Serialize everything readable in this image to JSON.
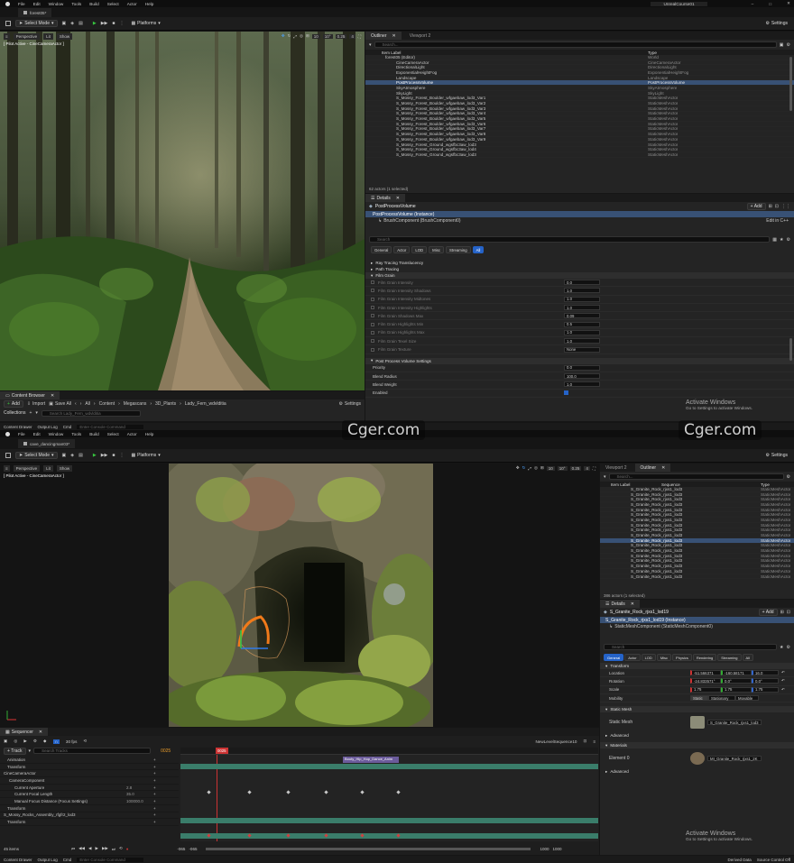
{
  "top": {
    "menu": [
      "File",
      "Edit",
      "Window",
      "Tools",
      "Build",
      "Select",
      "Actor",
      "Help"
    ],
    "tab_title": "forest05*",
    "window_title": "UnrealCourse01",
    "toolbar": {
      "select_mode": "Select Mode",
      "platforms": "Platforms",
      "settings": "Settings"
    },
    "viewport": {
      "perspective": "Perspective",
      "lit": "Lit",
      "show": "Show",
      "pilot": "[ Pilot Active - CineCameraActor ]",
      "grid": "10",
      "angle": "10°",
      "scale": "0.25",
      "cam": "4"
    },
    "outliner": {
      "tab1": "Outliner",
      "tab2": "Viewport 2",
      "search_placeholder": "Search...",
      "col_label": "Item Label",
      "col_type": "Type",
      "rows": [
        {
          "label": "forest05 (Editor)",
          "type": "World"
        },
        {
          "label": "CineCameraActor",
          "type": "CineCameraActor"
        },
        {
          "label": "DirectionalLight",
          "type": "DirectionalLight"
        },
        {
          "label": "ExponentialHeightFog",
          "type": "ExponentialHeightFog"
        },
        {
          "label": "Landscape",
          "type": "Landscape"
        },
        {
          "label": "PostProcessVolume",
          "type": "PostProcessVolume"
        },
        {
          "label": "SkyAtmosphere",
          "type": "SkyAtmosphere"
        },
        {
          "label": "SkyLight",
          "type": "SkyLight"
        },
        {
          "label": "S_Mossy_Forest_Boulder_wfgaebaw_lod3_Var1",
          "type": "StaticMeshActor"
        },
        {
          "label": "S_Mossy_Forest_Boulder_wfgaebaw_lod3_Var2",
          "type": "StaticMeshActor"
        },
        {
          "label": "S_Mossy_Forest_Boulder_wfgaebaw_lod3_Var3",
          "type": "StaticMeshActor"
        },
        {
          "label": "S_Mossy_Forest_Boulder_wfgaebaw_lod3_Var4",
          "type": "StaticMeshActor"
        },
        {
          "label": "S_Mossy_Forest_Boulder_wfgaebaw_lod3_Var5",
          "type": "StaticMeshActor"
        },
        {
          "label": "S_Mossy_Forest_Boulder_wfgaebaw_lod3_Var6",
          "type": "StaticMeshActor"
        },
        {
          "label": "S_Mossy_Forest_Boulder_wfgaebaw_lod3_Var7",
          "type": "StaticMeshActor"
        },
        {
          "label": "S_Mossy_Forest_Boulder_wfgaebaw_lod3_Var8",
          "type": "StaticMeshActor"
        },
        {
          "label": "S_Mossy_Forest_Boulder_wfgaebaw_lod3_Var9",
          "type": "StaticMeshActor"
        },
        {
          "label": "S_Mossy_Forest_Ground_wgsfbc3aw_lod3",
          "type": "StaticMeshActor"
        },
        {
          "label": "S_Mossy_Forest_Ground_wgsfbc3aw_lod4",
          "type": "StaticMeshActor"
        },
        {
          "label": "S_Mossy_Forest_Ground_wgsfbc3aw_lod3",
          "type": "StaticMeshActor"
        }
      ],
      "status": "62 actors (1 selected)"
    },
    "details": {
      "tab": "Details",
      "object": "PostProcessVolume",
      "add": "+ Add",
      "instance": "PostProcessVolume (Instance)",
      "component": "BrushComponent (BrushComponent0)",
      "edit_cpp": "Edit in C++",
      "search_placeholder": "Search",
      "filters": [
        "General",
        "Actor",
        "LOD",
        "Misc",
        "Streaming",
        "All"
      ],
      "sections": [
        "Ray Tracing Translucency",
        "Path Tracing",
        "Film Grain"
      ],
      "film_grain_rows": [
        {
          "label": "Film Grain Intensity",
          "value": "0.0"
        },
        {
          "label": "Film Grain Intensity Shadows",
          "value": "1.0"
        },
        {
          "label": "Film Grain Intensity Midtones",
          "value": "1.0"
        },
        {
          "label": "Film Grain Intensity Highlights",
          "value": "1.0"
        },
        {
          "label": "Film Grain Shadows Max",
          "value": "0.09"
        },
        {
          "label": "Film Grain Highlights Min",
          "value": "0.5"
        },
        {
          "label": "Film Grain Highlights Max",
          "value": "1.0"
        },
        {
          "label": "Film Grain Texel Size",
          "value": "1.0"
        },
        {
          "label": "Film Grain Texture",
          "value": "None"
        }
      ],
      "pp_section": "Post Process Volume Settings",
      "pp_rows": [
        {
          "label": "Priority",
          "value": "0.0"
        },
        {
          "label": "Blend Radius",
          "value": "100.0"
        },
        {
          "label": "Blend Weight",
          "value": "1.0"
        },
        {
          "label": "Enabled",
          "value": ""
        }
      ]
    },
    "content_browser": {
      "title": "Content Browser",
      "add": "Add",
      "import": "Import",
      "save_all": "Save All",
      "path": [
        "All",
        "Content",
        "Megascans",
        "3D_Plants",
        "Lady_Fern_wdvlditia"
      ],
      "settings": "Settings",
      "collections": "Collections",
      "search": "Search Lady_Fern_wdvlditia"
    },
    "status": {
      "drawer": "Content Drawer",
      "log": "Output Log",
      "cmd": "Cmd",
      "console": "Enter Console Command"
    },
    "activate": {
      "title": "Activate Windows",
      "sub": "Go to Settings to activate Windows."
    }
  },
  "bottom": {
    "menu": [
      "File",
      "Edit",
      "Window",
      "Tools",
      "Build",
      "Select",
      "Actor",
      "Help"
    ],
    "tab_title": "cave_dancingman03*",
    "toolbar": {
      "select_mode": "Select Mode",
      "platforms": "Platforms",
      "settings": "Settings"
    },
    "viewport": {
      "perspective": "Perspective",
      "lit": "Lit",
      "show": "Show",
      "pilot": "[ Pilot Active - CineCameraActor ]",
      "grid": "10",
      "angle": "10°",
      "scale": "0.25",
      "cam": "4"
    },
    "outliner": {
      "tab1": "Viewport 2",
      "tab2": "Outliner",
      "search_placeholder": "Search...",
      "col_label": "Item Label",
      "col_seq": "Sequence",
      "col_type": "Type",
      "rows": [
        {
          "label": "S_Granite_Rock_rjxs1_lod3",
          "type": "StaticMeshActor"
        },
        {
          "label": "S_Granite_Rock_rjxs1_lod3",
          "type": "StaticMeshActor"
        },
        {
          "label": "S_Granite_Rock_rjxs1_lod3",
          "type": "StaticMeshActor"
        },
        {
          "label": "S_Granite_Rock_rjxs1_lod3",
          "type": "StaticMeshActor"
        },
        {
          "label": "S_Granite_Rock_rjxs1_lod3",
          "type": "StaticMeshActor"
        },
        {
          "label": "S_Granite_Rock_rjxs1_lod3",
          "type": "StaticMeshActor"
        },
        {
          "label": "S_Granite_Rock_rjxs1_lod3",
          "type": "StaticMeshActor"
        },
        {
          "label": "S_Granite_Rock_rjxs1_lod3",
          "type": "StaticMeshActor"
        },
        {
          "label": "S_Granite_Rock_rjxs1_lod3",
          "type": "StaticMeshActor"
        },
        {
          "label": "S_Granite_Rock_rjxs1_lod3",
          "type": "StaticMeshActor"
        },
        {
          "label": "S_Granite_Rock_rjxs1_lod3",
          "type": "StaticMeshActor"
        },
        {
          "label": "S_Granite_Rock_rjxs1_lod3",
          "type": "StaticMeshActor"
        },
        {
          "label": "S_Granite_Rock_rjxs1_lod3",
          "type": "StaticMeshActor"
        },
        {
          "label": "S_Granite_Rock_rjxs1_lod3",
          "type": "StaticMeshActor"
        },
        {
          "label": "S_Granite_Rock_rjxs1_lod3",
          "type": "StaticMeshActor"
        },
        {
          "label": "S_Granite_Rock_rjxs1_lod3",
          "type": "StaticMeshActor"
        },
        {
          "label": "S_Granite_Rock_rjxs1_lod3",
          "type": "StaticMeshActor"
        },
        {
          "label": "S_Granite_Rock_rjxs1_lod3",
          "type": "StaticMeshActor"
        }
      ],
      "status": "386 actors (1 selected)"
    },
    "details": {
      "tab": "Details",
      "object": "S_Granite_Rock_rjxs1_lod19",
      "add": "+ Add",
      "instance": "S_Granite_Rock_rjxs1_lod19 (Instance)",
      "component": "StaticMeshComponent (StaticMeshComponent0)",
      "edit_cpp": "Edit in C++",
      "search_placeholder": "Search",
      "filters": [
        "General",
        "Actor",
        "LOD",
        "Misc",
        "Physics",
        "Rendering",
        "Streaming",
        "All"
      ],
      "transform": "Transform",
      "location": {
        "label": "Location",
        "x": "-51.566371",
        "y": "-160.58171",
        "z": "16.0"
      },
      "rotation": {
        "label": "Rotation",
        "x": "-24.833571°",
        "y": "0.0°",
        "z": "0.0°"
      },
      "scale": {
        "label": "Scale",
        "x": "1.75",
        "y": "1.75",
        "z": "1.75"
      },
      "mobility": {
        "label": "Mobility",
        "options": [
          "Static",
          "Stationary",
          "Movable"
        ]
      },
      "static_mesh_section": "Static Mesh",
      "static_mesh": {
        "label": "Static Mesh",
        "value": "S_Granite_Rock_rjxs1_lod3"
      },
      "advanced": "Advanced",
      "materials_section": "Materials",
      "element0": {
        "label": "Element 0",
        "value": "MI_Granite_Rock_rjxs1_2K"
      },
      "advanced2": "Advanced"
    },
    "sequencer": {
      "title": "Sequencer",
      "fps": "30 fps",
      "sequence_name": "NewLevelSequence10",
      "add_track": "+ Track",
      "search": "Search Tracks",
      "frame": "0025",
      "current_frame": "0025",
      "clip": "Booty_Hip_Hop_Dance_Anim",
      "tracks": [
        {
          "label": "Animation",
          "value": ""
        },
        {
          "label": "Transform",
          "value": ""
        },
        {
          "label": "CineCameraActor",
          "value": ""
        },
        {
          "label": "CameraComponent",
          "value": ""
        },
        {
          "label": "Current Aperture",
          "value": "2.8"
        },
        {
          "label": "Current Focal Length",
          "value": "35.0"
        },
        {
          "label": "Manual Focus Distance (Focus Settings)",
          "value": "100000.0"
        },
        {
          "label": "Transform",
          "value": ""
        },
        {
          "label": "S_Mossy_Rocks_Assembly_rfgfr2_lod3",
          "value": ""
        },
        {
          "label": "Transform",
          "value": ""
        }
      ],
      "items": "45 items",
      "start": "-065",
      "start2": "-065",
      "end": "1000",
      "end2": "1000"
    },
    "status": {
      "drawer": "Content Drawer",
      "log": "Output Log",
      "cmd": "Cmd",
      "console": "Enter Console Command",
      "derived": "Derived Data",
      "source": "Source Control Off"
    },
    "activate": {
      "title": "Activate Windows",
      "sub": "Go to Settings to activate Windows."
    }
  },
  "watermark": "Cger.com"
}
